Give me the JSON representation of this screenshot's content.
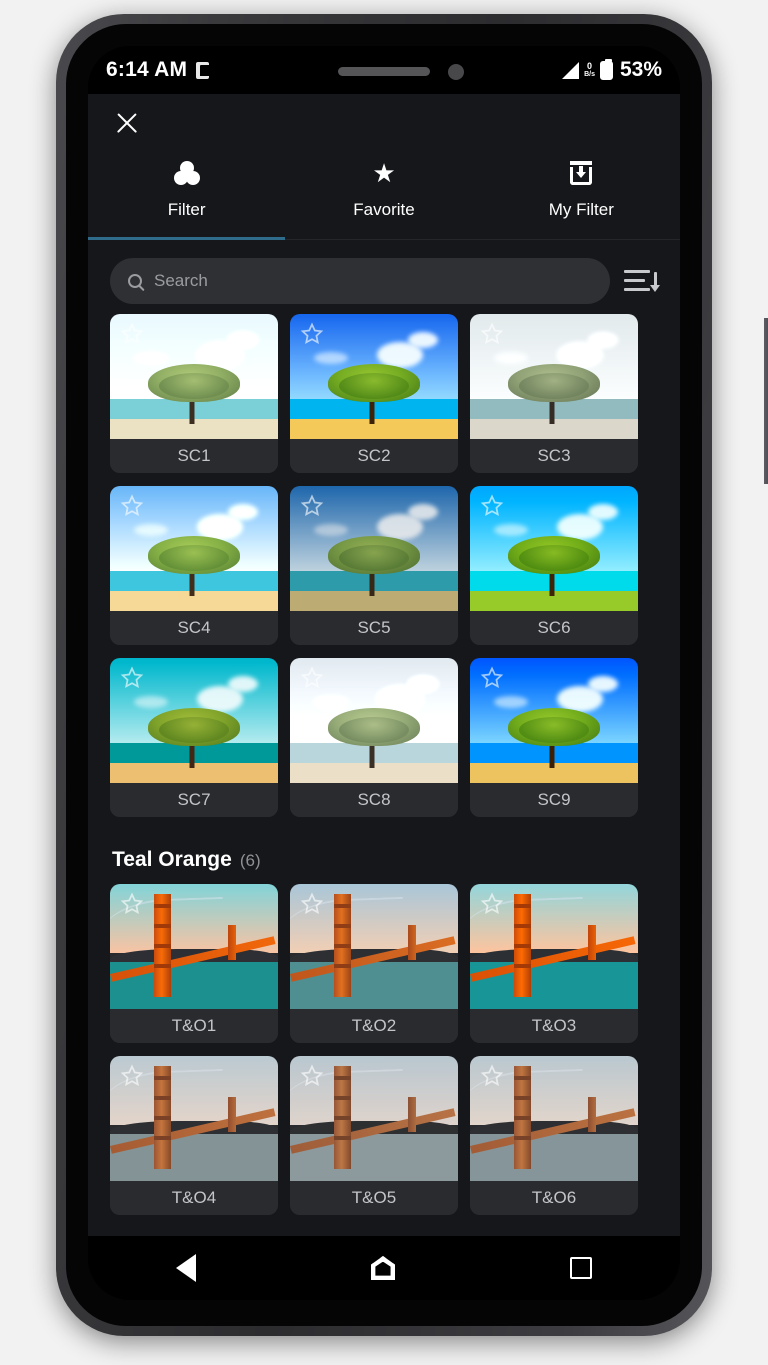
{
  "status_bar": {
    "time": "6:14 AM",
    "notification_icon": "notification-icon",
    "signal_icon": "signal-icon",
    "data_rate_value": "0",
    "data_rate_unit": "B/s",
    "battery_icon": "battery-icon",
    "battery_percent": "53%"
  },
  "app": {
    "close_label": "✕",
    "tabs": [
      {
        "label": "Filter",
        "icon": "color-filter-icon",
        "active": true
      },
      {
        "label": "Favorite",
        "icon": "star-icon",
        "active": false
      },
      {
        "label": "My Filter",
        "icon": "download-box-icon",
        "active": false
      }
    ],
    "search": {
      "placeholder": "Search",
      "value": "",
      "search_icon": "search-icon",
      "sort_icon": "sort-descending-icon"
    },
    "accent_color": "#2f6c8c",
    "background_color": "#16171a",
    "tile_color": "#2a2b2e",
    "sections": [
      {
        "title": "",
        "count": "",
        "rows": [
          [
            {
              "name": "SC1",
              "favorite": false
            },
            {
              "name": "SC2",
              "favorite": false
            },
            {
              "name": "SC3",
              "favorite": false
            }
          ],
          [
            {
              "name": "SC4",
              "favorite": false
            },
            {
              "name": "SC5",
              "favorite": false
            },
            {
              "name": "SC6",
              "favorite": false
            }
          ],
          [
            {
              "name": "SC7",
              "favorite": false
            },
            {
              "name": "SC8",
              "favorite": false
            },
            {
              "name": "SC9",
              "favorite": false
            }
          ]
        ]
      },
      {
        "title": "Teal Orange",
        "count": "(6)",
        "rows": [
          [
            {
              "name": "T&O1",
              "favorite": false
            },
            {
              "name": "T&O2",
              "favorite": false
            },
            {
              "name": "T&O3",
              "favorite": false
            }
          ],
          [
            {
              "name": "T&O4",
              "favorite": false
            },
            {
              "name": "T&O5",
              "favorite": false
            },
            {
              "name": "T&O6",
              "favorite": false
            }
          ]
        ]
      }
    ]
  },
  "nav_bar": {
    "back": "back-icon",
    "home": "home-icon",
    "recents": "recents-icon"
  }
}
